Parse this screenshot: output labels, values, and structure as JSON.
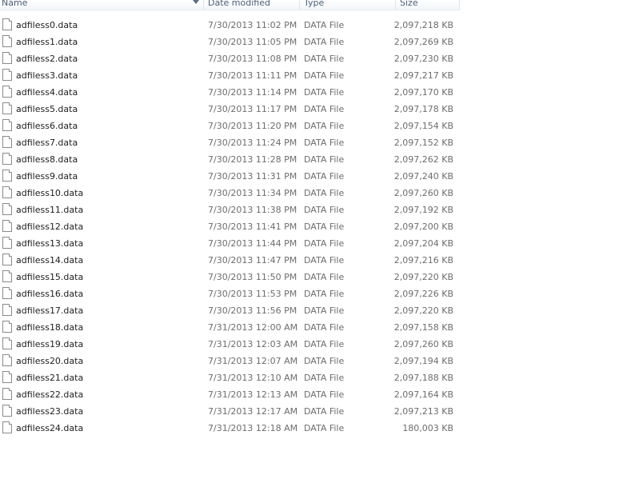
{
  "columns": {
    "name": "Name",
    "date_modified": "Date modified",
    "type": "Type",
    "size": "Size"
  },
  "icons": {
    "file": "document-file-icon",
    "sort": "sort-descending-arrow-icon"
  },
  "files": [
    {
      "name": "adfiless0.data",
      "date": "7/30/2013 11:02 PM",
      "type": "DATA File",
      "size": "2,097,218 KB"
    },
    {
      "name": "adfiless1.data",
      "date": "7/30/2013 11:05 PM",
      "type": "DATA File",
      "size": "2,097,269 KB"
    },
    {
      "name": "adfiless2.data",
      "date": "7/30/2013 11:08 PM",
      "type": "DATA File",
      "size": "2,097,230 KB"
    },
    {
      "name": "adfiless3.data",
      "date": "7/30/2013 11:11 PM",
      "type": "DATA File",
      "size": "2,097,217 KB"
    },
    {
      "name": "adfiless4.data",
      "date": "7/30/2013 11:14 PM",
      "type": "DATA File",
      "size": "2,097,170 KB"
    },
    {
      "name": "adfiless5.data",
      "date": "7/30/2013 11:17 PM",
      "type": "DATA File",
      "size": "2,097,178 KB"
    },
    {
      "name": "adfiless6.data",
      "date": "7/30/2013 11:20 PM",
      "type": "DATA File",
      "size": "2,097,154 KB"
    },
    {
      "name": "adfiless7.data",
      "date": "7/30/2013 11:24 PM",
      "type": "DATA File",
      "size": "2,097,152 KB"
    },
    {
      "name": "adfiless8.data",
      "date": "7/30/2013 11:28 PM",
      "type": "DATA File",
      "size": "2,097,262 KB"
    },
    {
      "name": "adfiless9.data",
      "date": "7/30/2013 11:31 PM",
      "type": "DATA File",
      "size": "2,097,240 KB"
    },
    {
      "name": "adfiless10.data",
      "date": "7/30/2013 11:34 PM",
      "type": "DATA File",
      "size": "2,097,260 KB"
    },
    {
      "name": "adfiless11.data",
      "date": "7/30/2013 11:38 PM",
      "type": "DATA File",
      "size": "2,097,192 KB"
    },
    {
      "name": "adfiless12.data",
      "date": "7/30/2013 11:41 PM",
      "type": "DATA File",
      "size": "2,097,200 KB"
    },
    {
      "name": "adfiless13.data",
      "date": "7/30/2013 11:44 PM",
      "type": "DATA File",
      "size": "2,097,204 KB"
    },
    {
      "name": "adfiless14.data",
      "date": "7/30/2013 11:47 PM",
      "type": "DATA File",
      "size": "2,097,216 KB"
    },
    {
      "name": "adfiless15.data",
      "date": "7/30/2013 11:50 PM",
      "type": "DATA File",
      "size": "2,097,220 KB"
    },
    {
      "name": "adfiless16.data",
      "date": "7/30/2013 11:53 PM",
      "type": "DATA File",
      "size": "2,097,226 KB"
    },
    {
      "name": "adfiless17.data",
      "date": "7/30/2013 11:56 PM",
      "type": "DATA File",
      "size": "2,097,220 KB"
    },
    {
      "name": "adfiless18.data",
      "date": "7/31/2013 12:00 AM",
      "type": "DATA File",
      "size": "2,097,158 KB"
    },
    {
      "name": "adfiless19.data",
      "date": "7/31/2013 12:03 AM",
      "type": "DATA File",
      "size": "2,097,260 KB"
    },
    {
      "name": "adfiless20.data",
      "date": "7/31/2013 12:07 AM",
      "type": "DATA File",
      "size": "2,097,194 KB"
    },
    {
      "name": "adfiless21.data",
      "date": "7/31/2013 12:10 AM",
      "type": "DATA File",
      "size": "2,097,188 KB"
    },
    {
      "name": "adfiless22.data",
      "date": "7/31/2013 12:13 AM",
      "type": "DATA File",
      "size": "2,097,164 KB"
    },
    {
      "name": "adfiless23.data",
      "date": "7/31/2013 12:17 AM",
      "type": "DATA File",
      "size": "2,097,213 KB"
    },
    {
      "name": "adfiless24.data",
      "date": "7/31/2013 12:18 AM",
      "type": "DATA File",
      "size": "180,003 KB"
    }
  ]
}
